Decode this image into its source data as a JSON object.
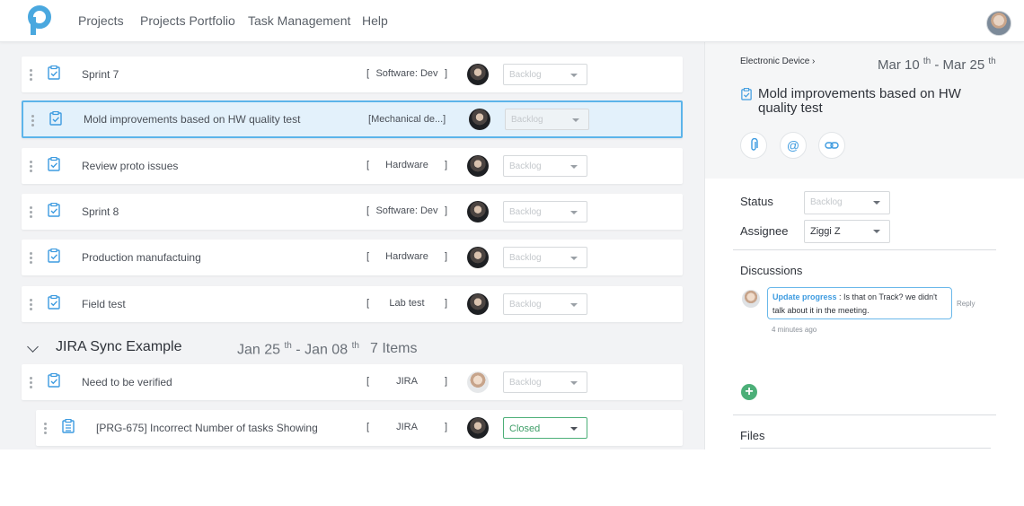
{
  "nav": {
    "items": [
      "Projects",
      "Projects Portfolio",
      "Task Management",
      "Help"
    ]
  },
  "colors": {
    "accent": "#3d9be0",
    "success": "#4caf78",
    "selected_border": "#5cb4ea"
  },
  "tasks": [
    {
      "name": "Sprint 7",
      "tag_open": "[",
      "tag": "Software: Dev",
      "tag_close": "]",
      "status": "Backlog",
      "avatar": "dark"
    },
    {
      "name": "Mold improvements based on HW quality test",
      "tag_open": "[",
      "tag": "Mechanical de...]",
      "tag_close": "",
      "status": "Backlog",
      "avatar": "dark",
      "selected": true
    },
    {
      "name": "Review proto issues",
      "tag_open": "[",
      "tag": "Hardware",
      "tag_close": "]",
      "status": "Backlog",
      "avatar": "dark"
    },
    {
      "name": "Sprint 8",
      "tag_open": "[",
      "tag": "Software: Dev",
      "tag_close": "]",
      "status": "Backlog",
      "avatar": "dark"
    },
    {
      "name": "Production manufactuing",
      "tag_open": "[",
      "tag": "Hardware",
      "tag_close": "]",
      "status": "Backlog",
      "avatar": "dark"
    },
    {
      "name": "Field test",
      "tag_open": "[",
      "tag": "Lab test",
      "tag_close": "]",
      "status": "Backlog",
      "avatar": "dark"
    }
  ],
  "group": {
    "title": "JIRA Sync Example",
    "date_start": "Jan 25",
    "date_start_sup": "th",
    "date_sep": " - ",
    "date_end": "Jan 08",
    "date_end_sup": "th",
    "count": "7 Items",
    "tasks": [
      {
        "name": "Need to be verified",
        "tag_open": "[",
        "tag": "JIRA",
        "tag_close": "]",
        "status": "Backlog",
        "avatar": "light"
      },
      {
        "name": "[PRG-675] Incorrect Number of tasks Showing",
        "tag_open": "[",
        "tag": "JIRA",
        "tag_close": "]",
        "status": "Closed",
        "avatar": "dark"
      }
    ]
  },
  "detail": {
    "breadcrumb": "Electronic Device",
    "date_start": "Mar 10",
    "date_start_sup": "th",
    "date_sep": " - ",
    "date_end": "Mar 25",
    "date_end_sup": "th",
    "title": "Mold improvements based on HW quality test",
    "action_icons": [
      "paperclip-icon",
      "at-icon",
      "link-icon"
    ],
    "status_label": "Status",
    "status_value": "Backlog",
    "assignee_label": "Assignee",
    "assignee_value": "Ziggi Z",
    "discussions_label": "Discussions",
    "comment": {
      "author": "Update progress",
      "text": " : Is that on Track? we didn't talk about it in the meeting.",
      "reply": "Reply",
      "time": "4 minutes ago"
    },
    "add_symbol": "+",
    "files_label": "Files"
  }
}
